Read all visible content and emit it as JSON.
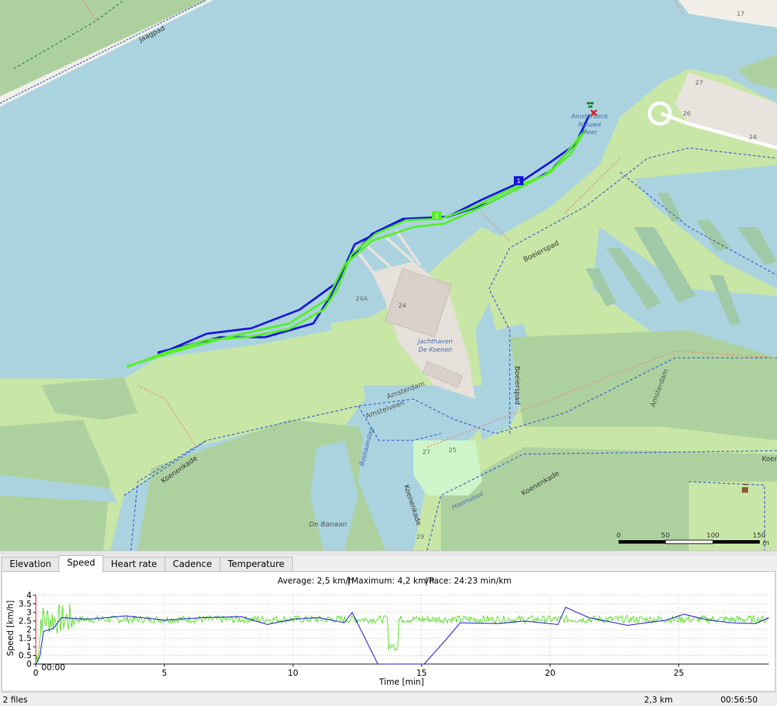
{
  "map": {
    "street_labels": [
      "Jaagpad",
      "Boeierspad",
      "Boeierspad",
      "Koenenkade",
      "Koenenkade",
      "Koenenkade",
      "Amsterdam",
      "Amstelveen",
      "Amsterdam",
      "Bosbaanslag",
      "Koen"
    ],
    "water_labels": [
      "Jachthaven",
      "De Koenen",
      "Hoornsloot",
      "De Banaan"
    ],
    "poi_labels": [
      "Amsterdeck",
      "Nieuwe",
      "Meer"
    ],
    "house_numbers": [
      "17",
      "27",
      "26",
      "24",
      "24",
      "24A",
      "27",
      "25",
      "29"
    ],
    "markers": {
      "blue_waypoint": "1",
      "green_waypoint": "1"
    },
    "scale": {
      "ticks": [
        "0",
        "50",
        "100",
        "150"
      ],
      "unit": "m"
    },
    "tracks": [
      {
        "color": "#1515dd",
        "name": "track-blue"
      },
      {
        "color": "#55ee22",
        "name": "track-green"
      }
    ]
  },
  "tabs": [
    "Elevation",
    "Speed",
    "Heart rate",
    "Cadence",
    "Temperature"
  ],
  "active_tab": "Speed",
  "graph": {
    "summary": {
      "average": "Average: 2,5 km/h",
      "maximum": "Maximum: 4,2 km/h",
      "pace": "Pace: 24:23 min/km"
    },
    "marker_time": "00:00"
  },
  "chart_data": {
    "type": "line",
    "title": "",
    "xlabel": "Time [min]",
    "ylabel": "Speed [km/h]",
    "xlim": [
      0,
      28.5
    ],
    "ylim": [
      0,
      4
    ],
    "x_ticks": [
      0,
      5,
      10,
      15,
      20,
      25
    ],
    "y_ticks": [
      0,
      0.5,
      1,
      1.5,
      2,
      2.5,
      3,
      3.5,
      4
    ],
    "y_tick_labels": [
      "0",
      "0.5",
      "1",
      "1.5",
      "2",
      "2.5",
      "3",
      "3.5",
      "4"
    ],
    "grid": true,
    "series": [
      {
        "color": "#0000cc",
        "x": [
          0,
          0.15,
          0.3,
          0.55,
          0.7,
          1.0,
          2.0,
          3.5,
          5.0,
          6.5,
          8.0,
          9.0,
          10.0,
          11.0,
          12.0,
          12.3,
          13.3,
          13.6,
          15.1,
          16.0,
          16.5,
          18.0,
          19.0,
          20.3,
          20.6,
          21.5,
          23.0,
          24.5,
          25.2,
          26.0,
          27.0,
          28.0,
          28.5
        ],
        "y": [
          0,
          0.4,
          1.9,
          2.0,
          2.1,
          2.7,
          2.6,
          2.8,
          2.55,
          2.7,
          2.75,
          2.3,
          2.6,
          2.7,
          2.4,
          3.0,
          0.0,
          0.0,
          0.0,
          1.5,
          2.4,
          2.35,
          2.5,
          2.3,
          3.3,
          2.7,
          2.25,
          2.55,
          2.9,
          2.6,
          2.4,
          2.35,
          2.7
        ]
      },
      {
        "color": "#55dd22",
        "x": [
          0,
          28.5
        ],
        "y": [
          2.6,
          2.6
        ],
        "note_only": ""
      }
    ]
  },
  "status": {
    "files": "2 files",
    "distance": "2,3 km",
    "time": "00:56:50"
  }
}
